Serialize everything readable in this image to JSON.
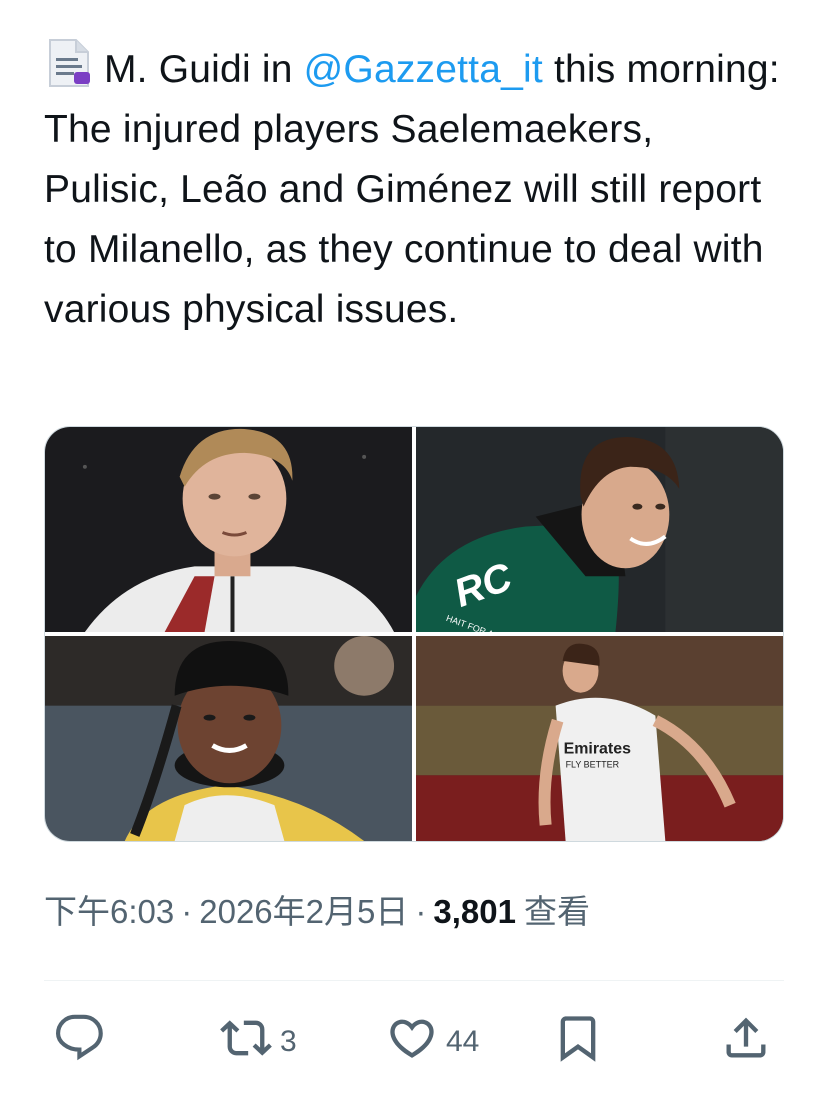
{
  "tweet": {
    "text_before": "M. Guidi in ",
    "mention": "@Gazzetta_it",
    "text_after": " this morning: The injured players Saelemaekers, Pulisic, Leão and Giménez will still report to Milanello, as they continue to deal with various physical issues.",
    "leading_icon": "document-icon"
  },
  "media": {
    "photos": [
      {
        "subject": "player-portrait-1"
      },
      {
        "subject": "player-portrait-2",
        "shirt_text": "RC",
        "shirt_subtext": "HAIT FOR AFRICA"
      },
      {
        "subject": "player-portrait-3"
      },
      {
        "subject": "player-action-4",
        "shirt_text": "Emirates",
        "shirt_subtext": "FLY BETTER"
      }
    ]
  },
  "meta": {
    "time": "下午6:03",
    "date": "2026年2月5日",
    "separator": "·",
    "views_count": "3,801",
    "views_label": "查看"
  },
  "actions": {
    "reply": {
      "icon": "reply-icon",
      "count": ""
    },
    "retweet": {
      "icon": "retweet-icon",
      "count": "3"
    },
    "like": {
      "icon": "heart-icon",
      "count": "44"
    },
    "bookmark": {
      "icon": "bookmark-icon",
      "count": ""
    },
    "share": {
      "icon": "share-icon",
      "count": ""
    }
  },
  "colors": {
    "accent": "#1d9bf0",
    "text": "#0f1419",
    "secondary": "#536471"
  }
}
